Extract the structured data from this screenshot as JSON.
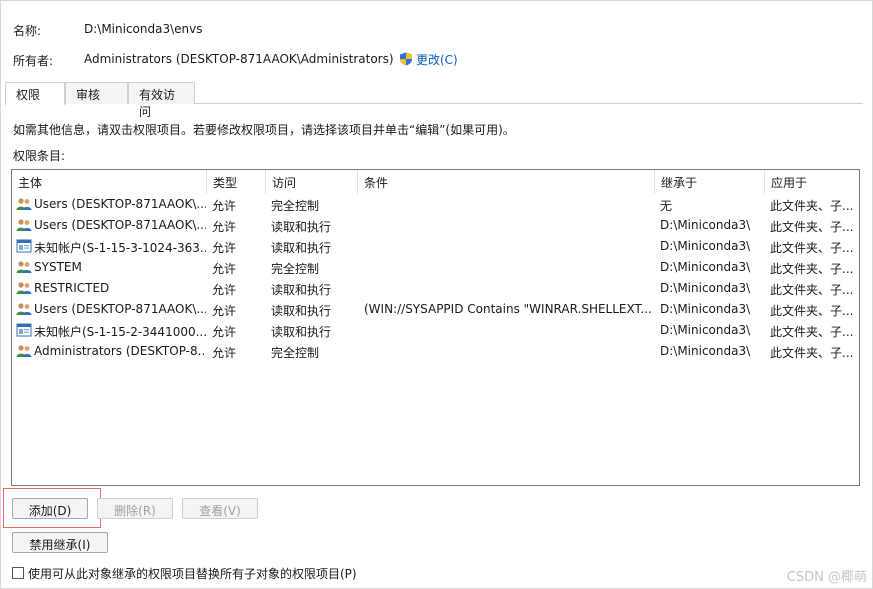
{
  "info": {
    "name_label": "名称:",
    "name_value": "D:\\Miniconda3\\envs",
    "owner_label": "所有者:",
    "owner_value": "Administrators (DESKTOP-871AAOK\\Administrators)",
    "change_link": "更改(C)"
  },
  "tabs": [
    {
      "label": "权限",
      "active": true
    },
    {
      "label": "审核",
      "active": false
    },
    {
      "label": "有效访问",
      "active": false
    }
  ],
  "instructions": "如需其他信息，请双击权限项目。若要修改权限项目，请选择该项目并单击“编辑”(如果可用)。",
  "entries_label": "权限条目:",
  "columns": [
    "主体",
    "类型",
    "访问",
    "条件",
    "继承于",
    "应用于"
  ],
  "rows": [
    {
      "icon": "users-group-icon",
      "principal": "Users (DESKTOP-871AAOK\\...",
      "type": "允许",
      "access": "完全控制",
      "condition": "",
      "inherited": "无",
      "applies": "此文件夹、子..."
    },
    {
      "icon": "users-group-icon",
      "principal": "Users (DESKTOP-871AAOK\\...",
      "type": "允许",
      "access": "读取和执行",
      "condition": "",
      "inherited": "D:\\Miniconda3\\",
      "applies": "此文件夹、子..."
    },
    {
      "icon": "unknown-account-icon",
      "principal": "未知帐户(S-1-15-3-1024-363...",
      "type": "允许",
      "access": "读取和执行",
      "condition": "",
      "inherited": "D:\\Miniconda3\\",
      "applies": "此文件夹、子..."
    },
    {
      "icon": "users-group-icon",
      "principal": "SYSTEM",
      "type": "允许",
      "access": "完全控制",
      "condition": "",
      "inherited": "D:\\Miniconda3\\",
      "applies": "此文件夹、子..."
    },
    {
      "icon": "users-group-icon",
      "principal": "RESTRICTED",
      "type": "允许",
      "access": "读取和执行",
      "condition": "",
      "inherited": "D:\\Miniconda3\\",
      "applies": "此文件夹、子..."
    },
    {
      "icon": "users-group-icon",
      "principal": "Users (DESKTOP-871AAOK\\...",
      "type": "允许",
      "access": "读取和执行",
      "condition": "(WIN://SYSAPPID Contains \"WINRAR.SHELLEXT...",
      "inherited": "D:\\Miniconda3\\",
      "applies": "此文件夹、子..."
    },
    {
      "icon": "unknown-account-icon",
      "principal": "未知帐户(S-1-15-2-3441000...",
      "type": "允许",
      "access": "读取和执行",
      "condition": "",
      "inherited": "D:\\Miniconda3\\",
      "applies": "此文件夹、子..."
    },
    {
      "icon": "users-group-icon",
      "principal": "Administrators (DESKTOP-8...",
      "type": "允许",
      "access": "完全控制",
      "condition": "",
      "inherited": "D:\\Miniconda3\\",
      "applies": "此文件夹、子..."
    }
  ],
  "buttons": {
    "add": "添加(D)",
    "remove": "删除(R)",
    "view": "查看(V)",
    "disable_inheritance": "禁用继承(I)"
  },
  "replace_checkbox_label": "使用可从此对象继承的权限项目替换所有子对象的权限项目(P)",
  "watermark": "CSDN @椰萌"
}
